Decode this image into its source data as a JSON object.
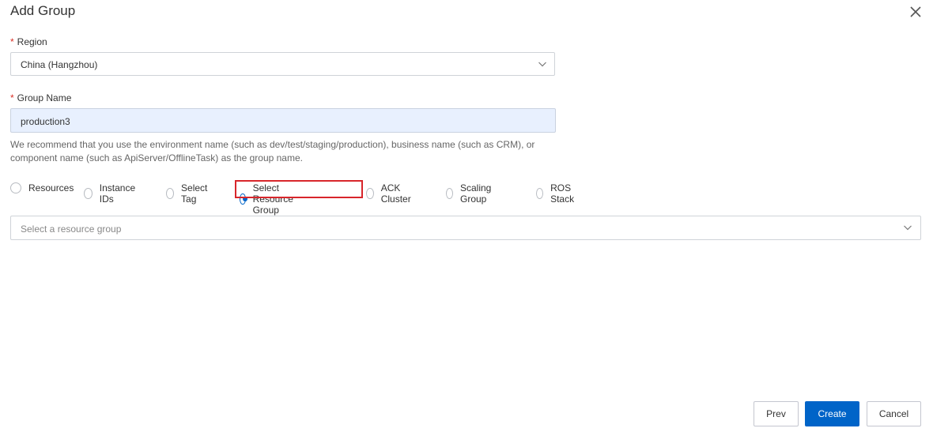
{
  "dialog": {
    "title": "Add Group"
  },
  "region": {
    "label": "Region",
    "required_mark": "*",
    "value": "China (Hangzhou)"
  },
  "group_name": {
    "label": "Group Name",
    "required_mark": "*",
    "value": "production3",
    "help_line1": "We recommend that you use the environment name (such as dev/test/staging/production), business name (such as CRM), or",
    "help_line2": "component name (such as ApiServer/OfflineTask) as the group name."
  },
  "source_options": {
    "items": [
      {
        "label": "Resources",
        "checked": false
      },
      {
        "label": "Instance IDs",
        "checked": false
      },
      {
        "label": "Select Tag",
        "checked": false
      },
      {
        "label": "Select Resource Group",
        "checked": true
      },
      {
        "label": "ACK Cluster",
        "checked": false
      },
      {
        "label": "Scaling Group",
        "checked": false
      },
      {
        "label": "ROS Stack",
        "checked": false
      }
    ]
  },
  "resource_group": {
    "placeholder": "Select a resource group"
  },
  "footer": {
    "prev_label": "Prev",
    "create_label": "Create",
    "cancel_label": "Cancel"
  },
  "colors": {
    "primary": "#0064c8",
    "highlight": "#d8262b",
    "required": "#d93026",
    "input_autofill_bg": "#e8f0fe"
  },
  "icons": [
    "close-icon",
    "chevron-down-icon"
  ]
}
